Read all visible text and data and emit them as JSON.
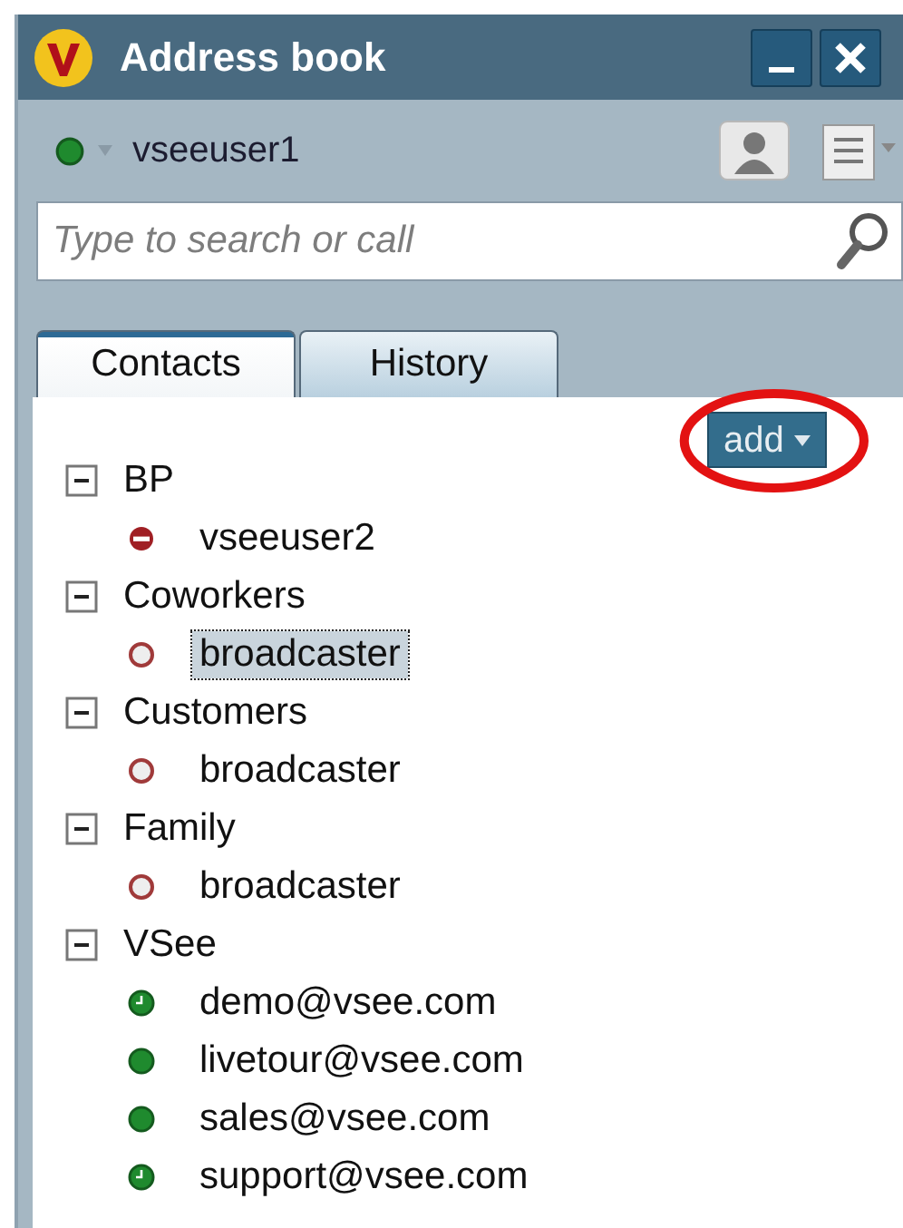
{
  "window": {
    "title": "Address book"
  },
  "user": {
    "name": "vseeuser1",
    "status": {
      "kind": "online",
      "color": "#1f8a2e"
    }
  },
  "search": {
    "placeholder": "Type to search or call"
  },
  "tabs": [
    {
      "label": "Contacts",
      "selected": true
    },
    {
      "label": "History",
      "selected": false
    }
  ],
  "add_button": {
    "label": "add",
    "circled": true
  },
  "groups": [
    {
      "name": "BP",
      "expanded": true,
      "children": [
        {
          "name": "vseeuser2",
          "kind": "busy",
          "color": "#a01f24",
          "selected": false
        }
      ]
    },
    {
      "name": "Coworkers",
      "expanded": true,
      "children": [
        {
          "name": "broadcaster",
          "kind": "offline",
          "color": "#eeeeee",
          "selected": true
        }
      ]
    },
    {
      "name": "Customers",
      "expanded": true,
      "children": [
        {
          "name": "broadcaster",
          "kind": "offline",
          "color": "#eeeeee",
          "selected": false
        }
      ]
    },
    {
      "name": "Family",
      "expanded": true,
      "children": [
        {
          "name": "broadcaster",
          "kind": "offline",
          "color": "#eeeeee",
          "selected": false
        }
      ]
    },
    {
      "name": "VSee",
      "expanded": true,
      "children": [
        {
          "name": "demo@vsee.com",
          "kind": "idle",
          "color": "#1f8a2e",
          "selected": false
        },
        {
          "name": "livetour@vsee.com",
          "kind": "online",
          "color": "#1f8a2e",
          "selected": false
        },
        {
          "name": "sales@vsee.com",
          "kind": "online",
          "color": "#1f8a2e",
          "selected": false
        },
        {
          "name": "support@vsee.com",
          "kind": "idle",
          "color": "#1f8a2e",
          "selected": false
        }
      ]
    }
  ]
}
